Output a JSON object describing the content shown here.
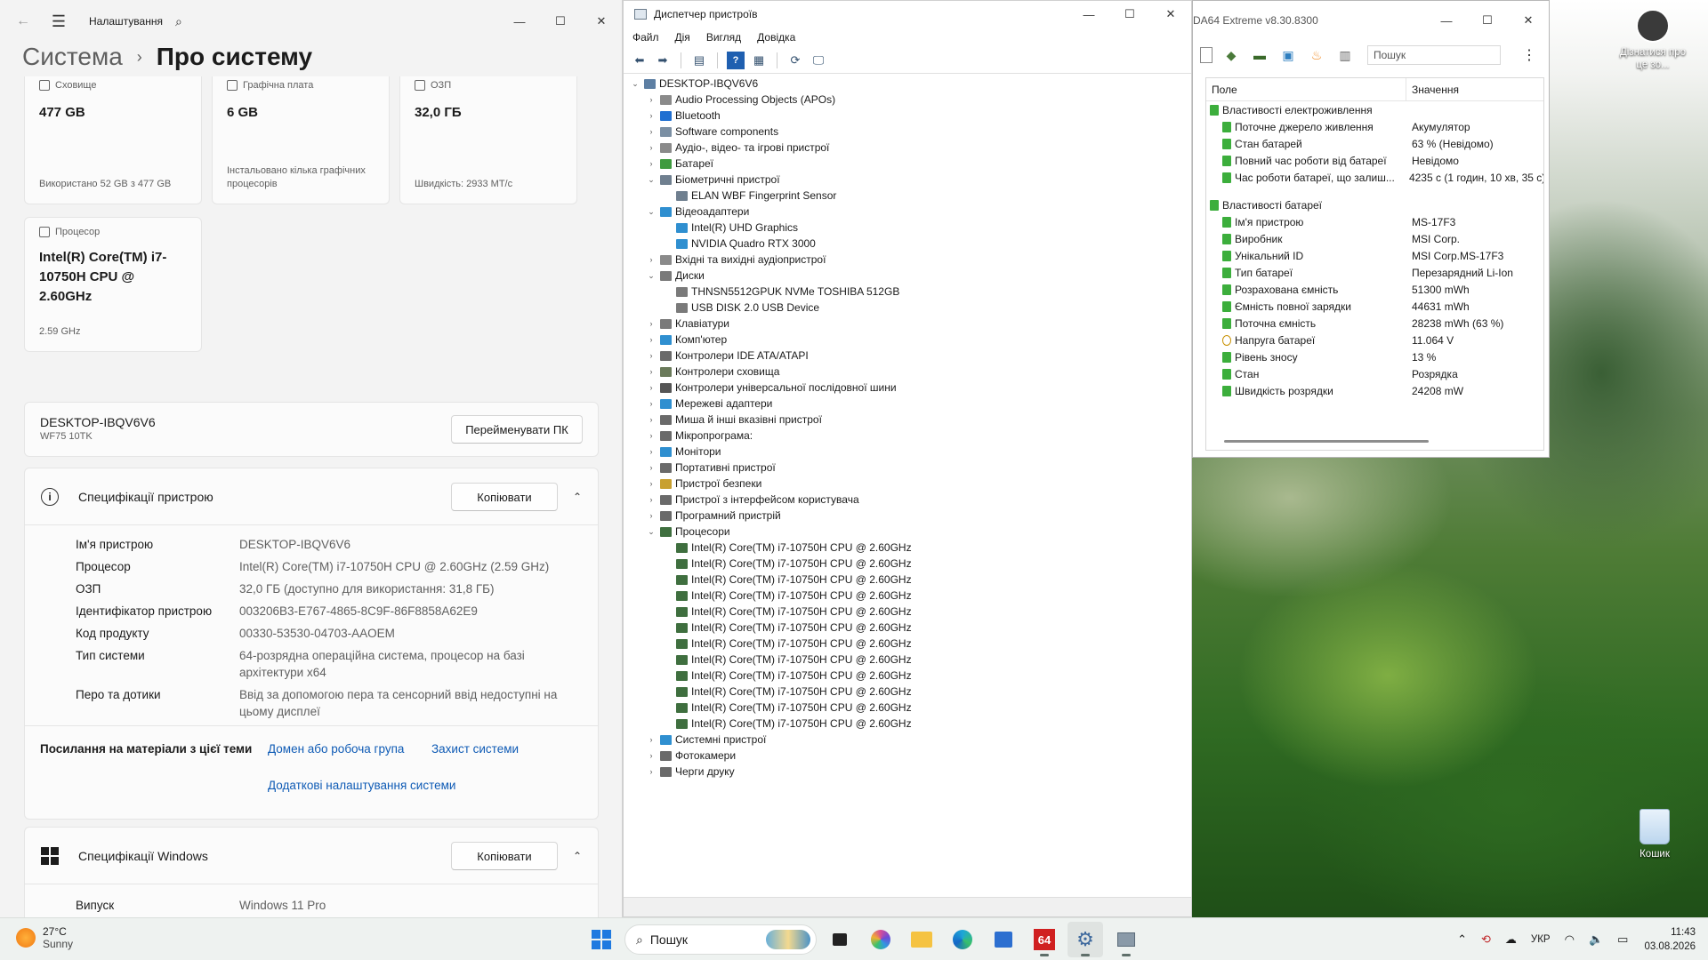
{
  "settings": {
    "title": "Налаштування",
    "breadcrumb_parent": "Система",
    "breadcrumb_sep": "›",
    "breadcrumb_current": "Про систему",
    "tiles": [
      {
        "label": "Сховище",
        "value": "477 GB",
        "sub": "Використано 52 GB з 477 GB"
      },
      {
        "label": "Графічна плата",
        "value": "6 GB",
        "sub": "Інстальовано кілька графічних процесорів"
      },
      {
        "label": "ОЗП",
        "value": "32,0 ГБ",
        "sub": "Швидкість: 2933 МТ/с"
      },
      {
        "label": "Процесор",
        "value": "Intel(R) Core(TM) i7-10750H CPU @ 2.60GHz",
        "sub": "2.59 GHz"
      }
    ],
    "pc_name": "DESKTOP-IBQV6V6",
    "pc_model": "WF75 10TK",
    "rename_button": "Перейменувати ПК",
    "device_spec_title": "Специфікації пристрою",
    "copy_button": "Копіювати",
    "device_specs": [
      {
        "k": "Ім'я пристрою",
        "v": "DESKTOP-IBQV6V6"
      },
      {
        "k": "Процесор",
        "v": "Intel(R) Core(TM) i7-10750H CPU @ 2.60GHz (2.59 GHz)"
      },
      {
        "k": "ОЗП",
        "v": "32,0 ГБ (доступно для використання: 31,8 ГБ)"
      },
      {
        "k": "Ідентифікатор пристрою",
        "v": "003206B3-E767-4865-8C9F-86F8858A62E9"
      },
      {
        "k": "Код продукту",
        "v": "00330-53530-04703-AAOEM"
      },
      {
        "k": "Тип системи",
        "v": "64-розрядна операційна система, процесор на базі архітектури x64"
      },
      {
        "k": "Перо та дотики",
        "v": "Ввід за допомогою пера та сенсорний ввід недоступні на цьому дисплеї"
      }
    ],
    "links_label": "Посилання на матеріали з цієї теми",
    "links": [
      "Домен або робоча група",
      "Захист системи",
      "Додаткові налаштування системи"
    ],
    "windows_spec_title": "Специфікації Windows",
    "windows_specs": [
      {
        "k": "Випуск",
        "v": "Windows 11 Pro"
      }
    ]
  },
  "devmgr": {
    "title": "Диспетчер пристроїв",
    "menu": [
      "Файл",
      "Дія",
      "Вигляд",
      "Довідка"
    ],
    "tree": [
      {
        "label": "DESKTOP-IBQV6V6",
        "level": 0,
        "exp": "v",
        "color": "#5d7fa3"
      },
      {
        "label": "Audio Processing Objects (APOs)",
        "level": 1,
        "exp": ">",
        "color": "#8a8a8a"
      },
      {
        "label": "Bluetooth",
        "level": 1,
        "exp": ">",
        "color": "#1f6fd1"
      },
      {
        "label": "Software components",
        "level": 1,
        "exp": ">",
        "color": "#7b8fa3"
      },
      {
        "label": "Аудіо-, відео- та ігрові пристрої",
        "level": 1,
        "exp": ">",
        "color": "#8a8a8a"
      },
      {
        "label": "Батареї",
        "level": 1,
        "exp": ">",
        "color": "#3f9b3f"
      },
      {
        "label": "Біометричні пристрої",
        "level": 1,
        "exp": "v",
        "color": "#6f7f8f"
      },
      {
        "label": "ELAN WBF Fingerprint Sensor",
        "level": 2,
        "exp": "",
        "color": "#6f7f8f"
      },
      {
        "label": "Відеоадаптери",
        "level": 1,
        "exp": "v",
        "color": "#2f8fd0"
      },
      {
        "label": "Intel(R) UHD Graphics",
        "level": 2,
        "exp": "",
        "color": "#2f8fd0"
      },
      {
        "label": "NVIDIA Quadro RTX 3000",
        "level": 2,
        "exp": "",
        "color": "#2f8fd0"
      },
      {
        "label": "Вхідні та вихідні аудіопристрої",
        "level": 1,
        "exp": ">",
        "color": "#8a8a8a"
      },
      {
        "label": "Диски",
        "level": 1,
        "exp": "v",
        "color": "#7a7a7a"
      },
      {
        "label": "THNSN5512GPUK NVMe TOSHIBA 512GB",
        "level": 2,
        "exp": "",
        "color": "#7a7a7a"
      },
      {
        "label": "USB DISK 2.0 USB Device",
        "level": 2,
        "exp": "",
        "color": "#7a7a7a"
      },
      {
        "label": "Клавіатури",
        "level": 1,
        "exp": ">",
        "color": "#7a7a7a"
      },
      {
        "label": "Комп'ютер",
        "level": 1,
        "exp": ">",
        "color": "#2f8fd0"
      },
      {
        "label": "Контролери IDE ATA/ATAPI",
        "level": 1,
        "exp": ">",
        "color": "#6a6a6a"
      },
      {
        "label": "Контролери сховища",
        "level": 1,
        "exp": ">",
        "color": "#6a7a5a"
      },
      {
        "label": "Контролери універсальної послідовної шини",
        "level": 1,
        "exp": ">",
        "color": "#555555"
      },
      {
        "label": "Мережеві адаптери",
        "level": 1,
        "exp": ">",
        "color": "#2f8fd0"
      },
      {
        "label": "Миша й інші вказівні пристрої",
        "level": 1,
        "exp": ">",
        "color": "#6a6a6a"
      },
      {
        "label": "Мікропрограма:",
        "level": 1,
        "exp": ">",
        "color": "#6a6a6a"
      },
      {
        "label": "Монітори",
        "level": 1,
        "exp": ">",
        "color": "#2f8fd0"
      },
      {
        "label": "Портативні пристрої",
        "level": 1,
        "exp": ">",
        "color": "#6a6a6a"
      },
      {
        "label": "Пристрої безпеки",
        "level": 1,
        "exp": ">",
        "color": "#c8a030"
      },
      {
        "label": "Пристрої з інтерфейсом користувача",
        "level": 1,
        "exp": ">",
        "color": "#6a6a6a"
      },
      {
        "label": "Програмний пристрій",
        "level": 1,
        "exp": ">",
        "color": "#6a6a6a"
      },
      {
        "label": "Процесори",
        "level": 1,
        "exp": "v",
        "color": "#3f6f3f"
      },
      {
        "label": "Intel(R) Core(TM) i7-10750H CPU @ 2.60GHz",
        "level": 2,
        "exp": "",
        "color": "#3f6f3f"
      },
      {
        "label": "Intel(R) Core(TM) i7-10750H CPU @ 2.60GHz",
        "level": 2,
        "exp": "",
        "color": "#3f6f3f"
      },
      {
        "label": "Intel(R) Core(TM) i7-10750H CPU @ 2.60GHz",
        "level": 2,
        "exp": "",
        "color": "#3f6f3f"
      },
      {
        "label": "Intel(R) Core(TM) i7-10750H CPU @ 2.60GHz",
        "level": 2,
        "exp": "",
        "color": "#3f6f3f"
      },
      {
        "label": "Intel(R) Core(TM) i7-10750H CPU @ 2.60GHz",
        "level": 2,
        "exp": "",
        "color": "#3f6f3f"
      },
      {
        "label": "Intel(R) Core(TM) i7-10750H CPU @ 2.60GHz",
        "level": 2,
        "exp": "",
        "color": "#3f6f3f"
      },
      {
        "label": "Intel(R) Core(TM) i7-10750H CPU @ 2.60GHz",
        "level": 2,
        "exp": "",
        "color": "#3f6f3f"
      },
      {
        "label": "Intel(R) Core(TM) i7-10750H CPU @ 2.60GHz",
        "level": 2,
        "exp": "",
        "color": "#3f6f3f"
      },
      {
        "label": "Intel(R) Core(TM) i7-10750H CPU @ 2.60GHz",
        "level": 2,
        "exp": "",
        "color": "#3f6f3f"
      },
      {
        "label": "Intel(R) Core(TM) i7-10750H CPU @ 2.60GHz",
        "level": 2,
        "exp": "",
        "color": "#3f6f3f"
      },
      {
        "label": "Intel(R) Core(TM) i7-10750H CPU @ 2.60GHz",
        "level": 2,
        "exp": "",
        "color": "#3f6f3f"
      },
      {
        "label": "Intel(R) Core(TM) i7-10750H CPU @ 2.60GHz",
        "level": 2,
        "exp": "",
        "color": "#3f6f3f"
      },
      {
        "label": "Системні пристрої",
        "level": 1,
        "exp": ">",
        "color": "#2f8fd0"
      },
      {
        "label": "Фотокамери",
        "level": 1,
        "exp": ">",
        "color": "#6a6a6a"
      },
      {
        "label": "Черги друку",
        "level": 1,
        "exp": ">",
        "color": "#6a6a6a"
      }
    ]
  },
  "aida": {
    "title": "DA64 Extreme v8.30.8300",
    "search_placeholder": "Пошук",
    "col_field": "Поле",
    "col_value": "Значення",
    "rows": [
      {
        "k": "Властивості електроживлення",
        "v": "",
        "group": true
      },
      {
        "k": "Поточне джерело живлення",
        "v": "Акумулятор"
      },
      {
        "k": "Стан батарей",
        "v": "63 % (Невідомо)"
      },
      {
        "k": "Повний час роботи від батареї",
        "v": "Невідомо"
      },
      {
        "k": "Час роботи батареї, що залиш...",
        "v": "4235 с (1 годин, 10 хв, 35 с)"
      },
      {
        "k": "",
        "v": "",
        "spacer": true
      },
      {
        "k": "Властивості батареї",
        "v": "",
        "group": true
      },
      {
        "k": "Ім'я пристрою",
        "v": "MS-17F3"
      },
      {
        "k": "Виробник",
        "v": "MSI Corp."
      },
      {
        "k": "Унікальний ID",
        "v": "MSI Corp.MS-17F3"
      },
      {
        "k": "Тип батареї",
        "v": "Перезарядний Li-Ion"
      },
      {
        "k": "Розрахована ємність",
        "v": "51300 mWh"
      },
      {
        "k": "Ємність повної зарядки",
        "v": "44631 mWh"
      },
      {
        "k": "Поточна ємність",
        "v": "28238 mWh  (63 %)"
      },
      {
        "k": "Напруга батареї",
        "v": "11.064 V",
        "warn": true
      },
      {
        "k": "Рівень зносу",
        "v": "13 %"
      },
      {
        "k": "Стан",
        "v": "Розрядка"
      },
      {
        "k": "Швидкість розрядки",
        "v": "24208 mW"
      }
    ]
  },
  "desktop": {
    "spotlight_label": "Дізнатися про це зо...",
    "recycle_label": "Кошик"
  },
  "taskbar": {
    "temp": "27°C",
    "condition": "Sunny",
    "search": "Пошук",
    "lang": "УКР",
    "time": "11:43",
    "date": "03.08.2026"
  }
}
